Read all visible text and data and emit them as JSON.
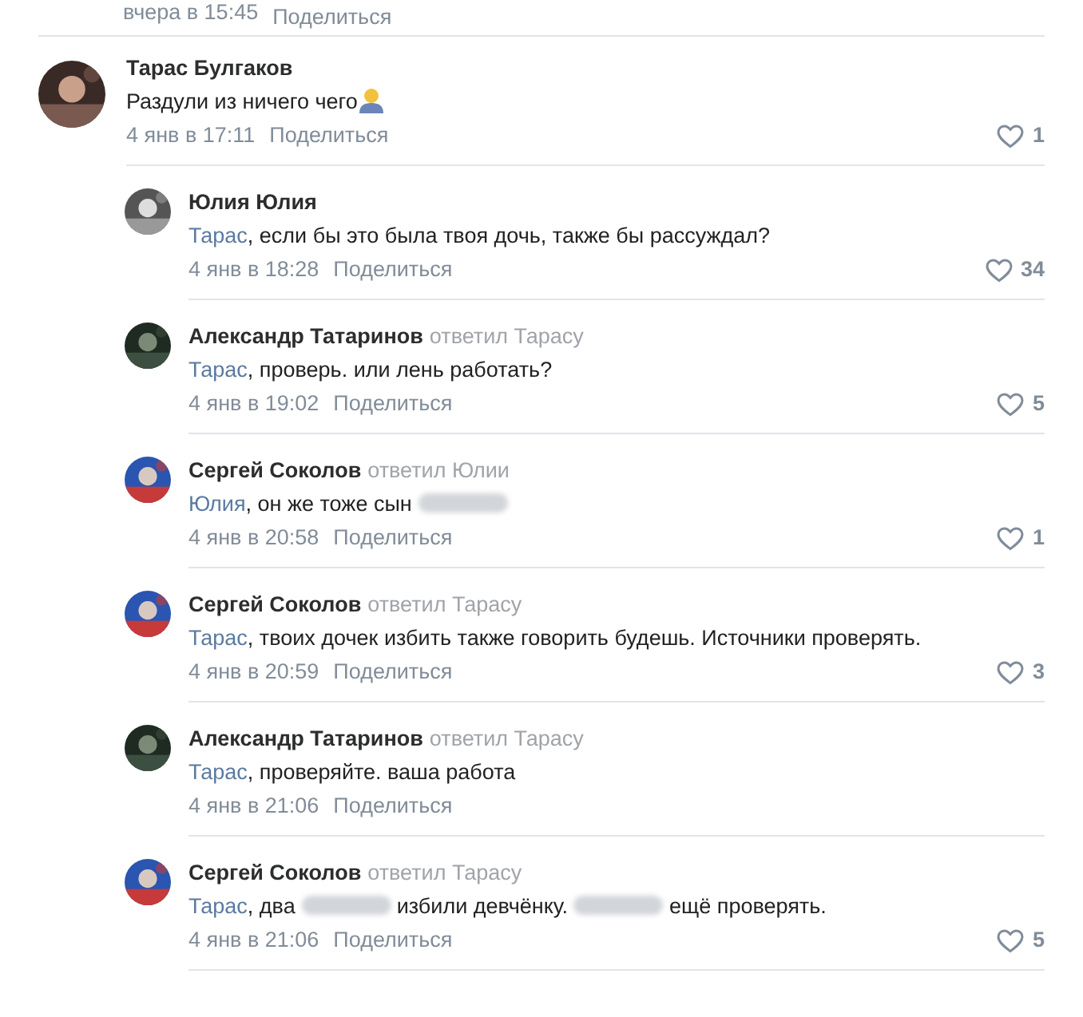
{
  "top_meta": {
    "date": "вчера в 15:45",
    "share": "Поделиться"
  },
  "comments": [
    {
      "author": "Тарас Булгаков",
      "parts": [
        {
          "kind": "text",
          "text": "Раздули из ничего чего"
        },
        {
          "kind": "emoji"
        }
      ],
      "date": "4 янв в 17:11",
      "share": "Поделиться",
      "likes": "1",
      "replies": [
        {
          "author": "Юлия Юлия",
          "parts": [
            {
              "kind": "mention",
              "text": "Тарас"
            },
            {
              "kind": "text",
              "text": ", если бы это была твоя дочь, также бы рассуждал?"
            }
          ],
          "date": "4 янв в 18:28",
          "share": "Поделиться",
          "likes": "34"
        },
        {
          "author": "Александр Татаринов",
          "reply_to": "ответил Тарасу",
          "parts": [
            {
              "kind": "mention",
              "text": "Тарас"
            },
            {
              "kind": "text",
              "text": ", проверь. или лень работать?"
            }
          ],
          "date": "4 янв в 19:02",
          "share": "Поделиться",
          "likes": "5"
        },
        {
          "author": "Сергей Соколов",
          "reply_to": "ответил Юлии",
          "parts": [
            {
              "kind": "mention",
              "text": "Юлия"
            },
            {
              "kind": "text",
              "text": ", он же тоже сын "
            },
            {
              "kind": "redacted"
            }
          ],
          "date": "4 янв в 20:58",
          "share": "Поделиться",
          "likes": "1"
        },
        {
          "author": "Сергей Соколов",
          "reply_to": "ответил Тарасу",
          "parts": [
            {
              "kind": "mention",
              "text": "Тарас"
            },
            {
              "kind": "text",
              "text": ", твоих дочек избить также говорить будешь. Источники проверять."
            }
          ],
          "date": "4 янв в 20:59",
          "share": "Поделиться",
          "likes": "3"
        },
        {
          "author": "Александр Татаринов",
          "reply_to": "ответил Тарасу",
          "parts": [
            {
              "kind": "mention",
              "text": "Тарас"
            },
            {
              "kind": "text",
              "text": ", проверяйте. ваша работа"
            }
          ],
          "date": "4 янв в 21:06",
          "share": "Поделиться"
        },
        {
          "author": "Сергей Соколов",
          "reply_to": "ответил Тарасу",
          "parts": [
            {
              "kind": "mention",
              "text": "Тарас"
            },
            {
              "kind": "text",
              "text": ", два "
            },
            {
              "kind": "redacted"
            },
            {
              "kind": "text",
              "text": " избили девчёнку. "
            },
            {
              "kind": "redacted"
            },
            {
              "kind": "text",
              "text": " ещё проверять."
            }
          ],
          "date": "4 янв в 21:06",
          "share": "Поделиться",
          "likes": "5"
        }
      ]
    }
  ]
}
